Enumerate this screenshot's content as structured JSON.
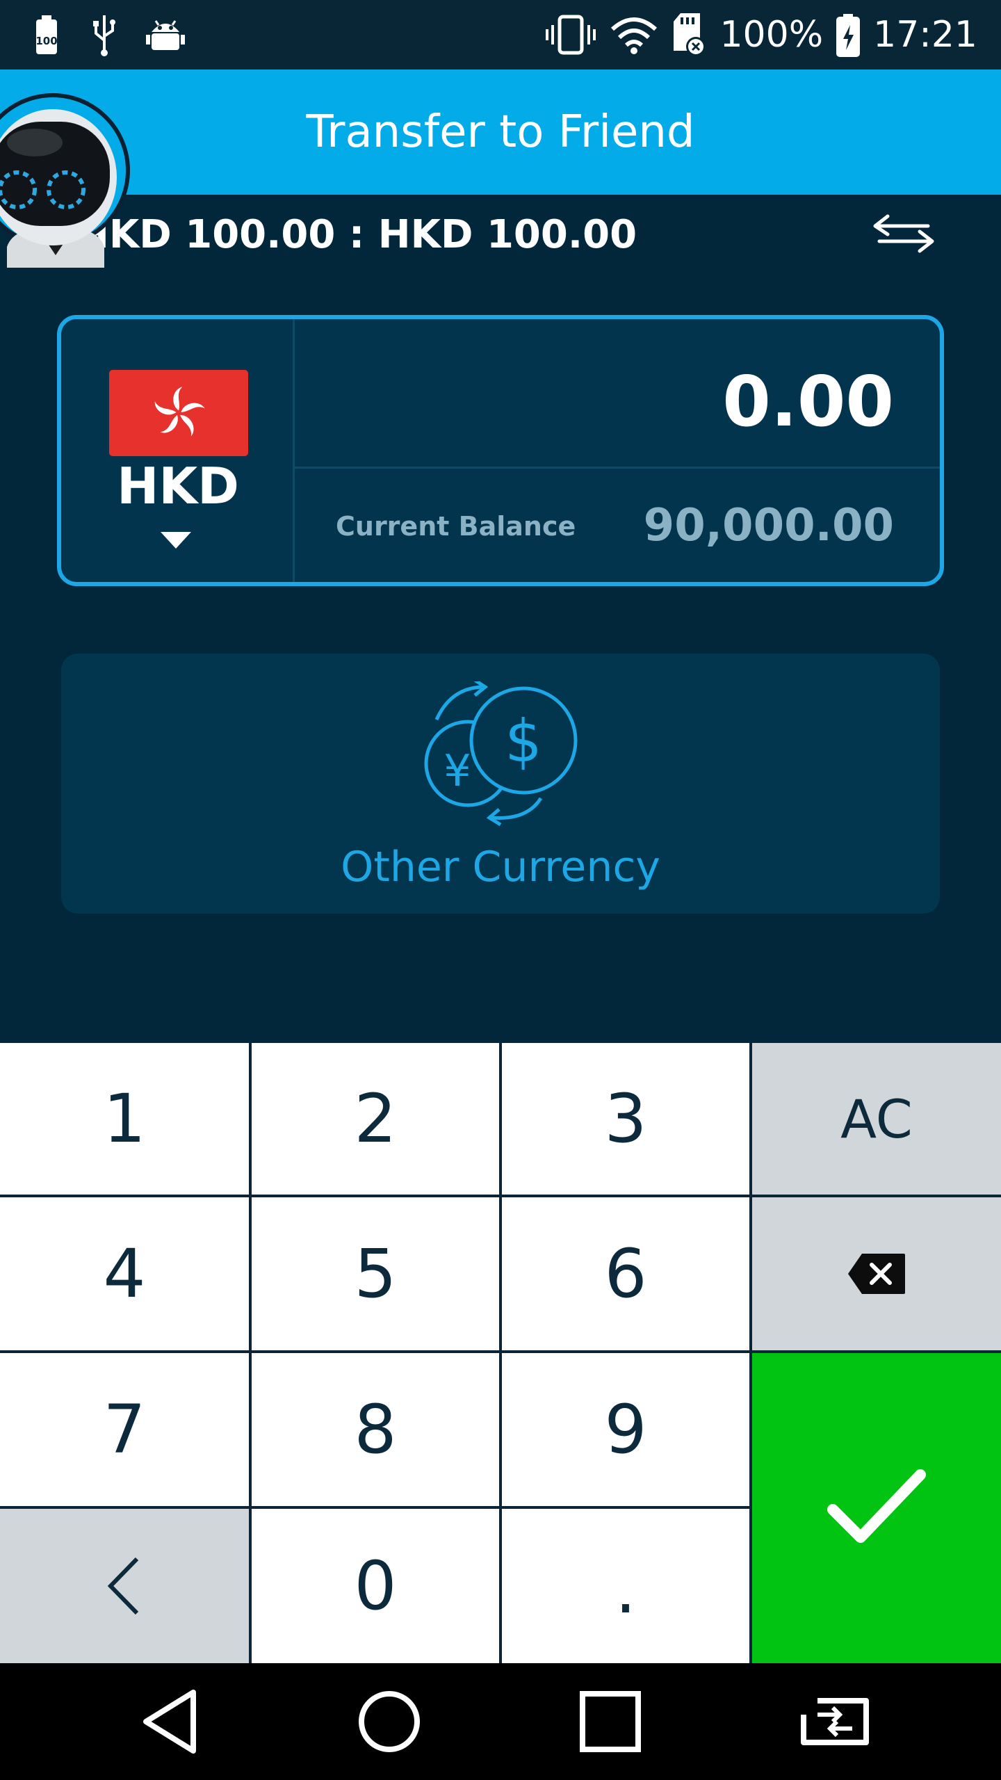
{
  "status_bar": {
    "battery_percent": "100%",
    "time": "17:21",
    "left_icons": [
      "battery-100-icon",
      "usb-icon",
      "android-debug-icon"
    ],
    "right_icons": [
      "vibrate-icon",
      "wifi-icon",
      "sd-card-icon",
      "battery-charging-icon"
    ]
  },
  "header": {
    "title": "Transfer to Friend"
  },
  "rate": {
    "text": "HKD 100.00 : HKD 100.00"
  },
  "amount_card": {
    "currency_code": "HKD",
    "amount": "0.00",
    "balance_label": "Current Balance",
    "balance_value": "90,000.00"
  },
  "other_currency": {
    "label": "Other Currency"
  },
  "keypad": {
    "keys": [
      "1",
      "2",
      "3",
      "AC",
      "4",
      "5",
      "6",
      "backspace-icon",
      "7",
      "8",
      "9",
      "confirm-check-icon",
      "back-chevron-icon",
      "0",
      "."
    ]
  },
  "nav_bar": {
    "buttons": [
      "back-triangle-icon",
      "home-circle-icon",
      "recents-square-icon",
      "switch-screen-icon"
    ]
  },
  "colors": {
    "header": "#03abe9",
    "background": "#02273b",
    "accent": "#1ca7e6",
    "confirm": "#00c312",
    "flag_red": "#e7312d"
  }
}
